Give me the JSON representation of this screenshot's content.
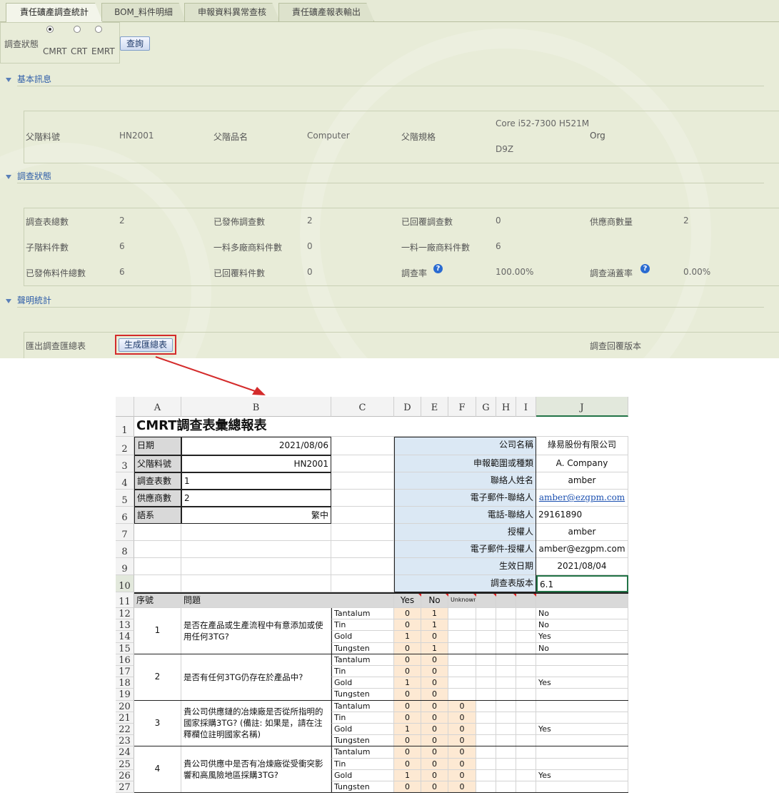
{
  "tabs": [
    "責任礦產調查統計",
    "BOM_料件明細",
    "申報資料異常查核",
    "責任礦產報表輸出"
  ],
  "survey_status_filter": {
    "label": "調查狀態",
    "options": [
      "CMRT",
      "CRT",
      "EMRT"
    ],
    "selected": "CMRT",
    "query_button": "查詢"
  },
  "basic_info": {
    "section_title": "基本訊息",
    "parent_part_no_label": "父階料號",
    "parent_part_no": "HN2001",
    "parent_name_label": "父階品名",
    "parent_name": "Computer",
    "parent_spec_label": "父階規格",
    "parent_spec_line1": "Core i52-7300 H521M",
    "parent_spec_line2": "D9Z",
    "parent_extra": "Org"
  },
  "survey_status": {
    "section_title": "調查狀態",
    "rows": [
      [
        {
          "label": "調查表總數",
          "value": "2"
        },
        {
          "label": "已發佈調查數",
          "value": "2"
        },
        {
          "label": "已回覆調查數",
          "value": "0"
        },
        {
          "label": "供應商數量",
          "value": "2"
        }
      ],
      [
        {
          "label": "子階料件數",
          "value": "6"
        },
        {
          "label": "一料多廠商料件數",
          "value": "0"
        },
        {
          "label": "一料一廠商料件數",
          "value": "6"
        }
      ],
      [
        {
          "label": "已發佈料件總數",
          "value": "6"
        },
        {
          "label": "已回覆料件數",
          "value": "0"
        },
        {
          "label": "調查率",
          "value": "100.00%"
        },
        {
          "label": "調查涵蓋率",
          "value": "0.00%"
        }
      ]
    ]
  },
  "declaration_stats": {
    "section_title": "聲明統計",
    "export_label": "匯出調查匯總表",
    "generate_button": "生成匯總表",
    "reply_version_label": "調查回覆版本"
  },
  "sheet": {
    "columns": [
      "A",
      "B",
      "C",
      "D",
      "E",
      "F",
      "G",
      "H",
      "I",
      "J"
    ],
    "rows": [
      "1",
      "2",
      "3",
      "4",
      "5",
      "6",
      "7",
      "8",
      "9",
      "10",
      "11",
      "12",
      "13",
      "14",
      "15",
      "16",
      "17",
      "18",
      "19",
      "20",
      "21",
      "22",
      "23",
      "24",
      "25",
      "26",
      "27"
    ],
    "title": "CMRT調查表彙總報表",
    "left_fields": [
      {
        "label": "日期",
        "value": "2021/08/06"
      },
      {
        "label": "父階料號",
        "value": "HN2001"
      },
      {
        "label": "調查表數",
        "value": "1"
      },
      {
        "label": "供應商數",
        "value": "2"
      },
      {
        "label": "語系",
        "value": "繁中"
      }
    ],
    "right_fields": [
      {
        "label": "公司名稱",
        "value": "綠易股份有限公司"
      },
      {
        "label": "申報範圍或種類",
        "value": "A. Company"
      },
      {
        "label": "聯絡人姓名",
        "value": "amber"
      },
      {
        "label": "電子郵件-聯絡人",
        "value": "amber@ezgpm.com"
      },
      {
        "label": "電話-聯絡人",
        "value": "29161890"
      },
      {
        "label": "授權人",
        "value": "amber"
      },
      {
        "label": "電子郵件-授權人",
        "value": "amber@ezgpm.com"
      },
      {
        "label": "生效日期",
        "value": "2021/08/04"
      },
      {
        "label": "調查表版本",
        "value": "6.1"
      }
    ],
    "header": {
      "seq": "序號",
      "question": "問題",
      "yes": "Yes",
      "no": "No",
      "unknown": "Unknown"
    },
    "questions": [
      {
        "no": "1",
        "text": "是否在產品或生產流程中有意添加或使用任何3TG?",
        "metals": [
          {
            "name": "Tantalum",
            "yes": "0",
            "no": "1",
            "unk": "",
            "ans": "No"
          },
          {
            "name": "Tin",
            "yes": "0",
            "no": "1",
            "unk": "",
            "ans": "No"
          },
          {
            "name": "Gold",
            "yes": "1",
            "no": "0",
            "unk": "",
            "ans": "Yes"
          },
          {
            "name": "Tungsten",
            "yes": "0",
            "no": "1",
            "unk": "",
            "ans": "No"
          }
        ]
      },
      {
        "no": "2",
        "text": "是否有任何3TG仍存在於產品中?",
        "metals": [
          {
            "name": "Tantalum",
            "yes": "0",
            "no": "0",
            "unk": "",
            "ans": ""
          },
          {
            "name": "Tin",
            "yes": "0",
            "no": "0",
            "unk": "",
            "ans": ""
          },
          {
            "name": "Gold",
            "yes": "1",
            "no": "0",
            "unk": "",
            "ans": "Yes"
          },
          {
            "name": "Tungsten",
            "yes": "0",
            "no": "0",
            "unk": "",
            "ans": ""
          }
        ]
      },
      {
        "no": "3",
        "text": "貴公司供應鏈的冶煉廠是否從所指明的國家採購3TG? (備註: 如果是，請在注釋欄位註明國家名稱)",
        "metals": [
          {
            "name": "Tantalum",
            "yes": "0",
            "no": "0",
            "unk": "0",
            "ans": ""
          },
          {
            "name": "Tin",
            "yes": "0",
            "no": "0",
            "unk": "0",
            "ans": ""
          },
          {
            "name": "Gold",
            "yes": "1",
            "no": "0",
            "unk": "0",
            "ans": "Yes"
          },
          {
            "name": "Tungsten",
            "yes": "0",
            "no": "0",
            "unk": "0",
            "ans": ""
          }
        ]
      },
      {
        "no": "4",
        "text": "貴公司供應中是否有冶煉廠從受衝突影響和高風險地區採購3TG?",
        "metals": [
          {
            "name": "Tantalum",
            "yes": "0",
            "no": "0",
            "unk": "0",
            "ans": ""
          },
          {
            "name": "Tin",
            "yes": "0",
            "no": "0",
            "unk": "0",
            "ans": ""
          },
          {
            "name": "Gold",
            "yes": "1",
            "no": "0",
            "unk": "0",
            "ans": "Yes"
          },
          {
            "name": "Tungsten",
            "yes": "0",
            "no": "0",
            "unk": "0",
            "ans": ""
          }
        ]
      }
    ]
  },
  "colors": {
    "ui_bg": "#e8ecd8",
    "section_title": "#2f5ea8",
    "sheet_blue": "#dbe8f4",
    "sheet_peach": "#fde9d3",
    "highlight_red": "#e02020"
  }
}
